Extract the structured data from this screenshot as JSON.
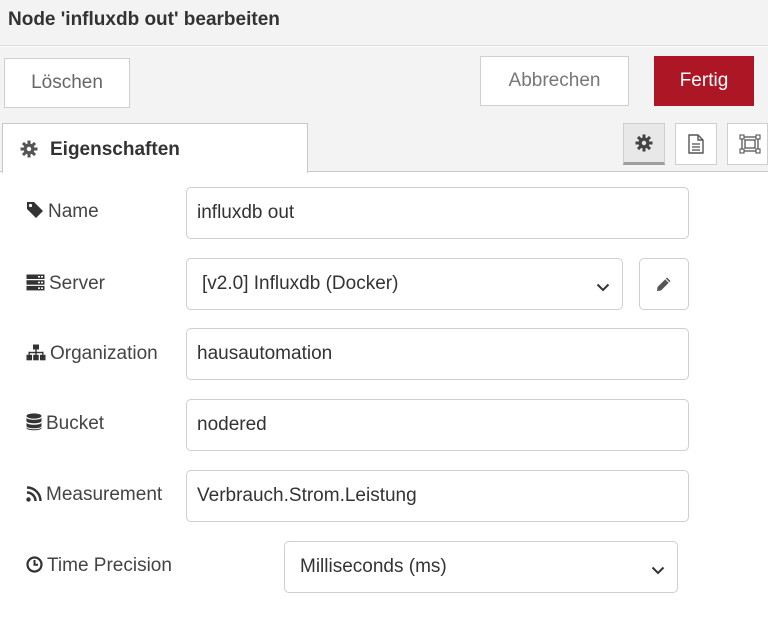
{
  "dialog": {
    "title": "Node 'influxdb out' bearbeiten"
  },
  "toolbar": {
    "delete_label": "Löschen",
    "cancel_label": "Abbrechen",
    "done_label": "Fertig"
  },
  "tabs": {
    "properties_label": "Eigenschaften",
    "buttons": [
      "gear-icon",
      "description-icon",
      "appearance-icon"
    ]
  },
  "form": {
    "name": {
      "label": "Name",
      "value": "influxdb out",
      "icon": "tag-icon"
    },
    "server": {
      "label": "Server",
      "value": "[v2.0] Influxdb (Docker)",
      "icon": "server-icon"
    },
    "organization": {
      "label": "Organization",
      "value": "hausautomation",
      "icon": "sitemap-icon"
    },
    "bucket": {
      "label": "Bucket",
      "value": "nodered",
      "icon": "database-icon"
    },
    "measurement": {
      "label": "Measurement",
      "value": "Verbrauch.Strom.Leistung",
      "icon": "rss-icon"
    },
    "time_precision": {
      "label": "Time Precision",
      "value": "Milliseconds (ms)",
      "icon": "clock-icon"
    }
  },
  "colors": {
    "done_button": "#ad1625",
    "toolbar_bg": "#f3f3f3"
  }
}
